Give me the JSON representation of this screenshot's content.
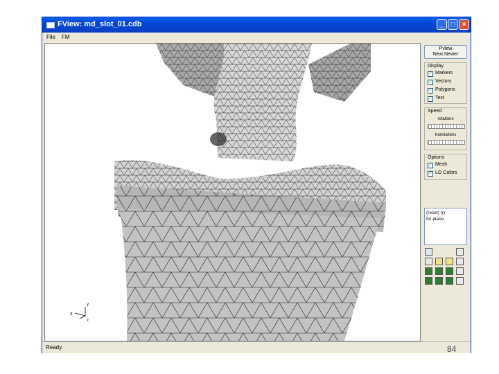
{
  "window": {
    "title": "FView: md_slot_01.cdb",
    "minimize": "_",
    "maximize": "□",
    "close": "×"
  },
  "menu": [
    "File",
    "FM"
  ],
  "panel": {
    "view_button": "Pvlew",
    "next_button": "Next Newer",
    "display": {
      "title": "Display",
      "items": [
        {
          "label": "Markers",
          "checked": true
        },
        {
          "label": "Vectors",
          "checked": true
        },
        {
          "label": "Polygons",
          "checked": true
        },
        {
          "label": "Text",
          "checked": true
        }
      ]
    },
    "speed": {
      "title": "Speed",
      "rotations_label": "rotations",
      "translations_label": "translations"
    },
    "options": {
      "title": "Options",
      "items": [
        {
          "label": "Mesh",
          "checked": true
        },
        {
          "label": "LO Colors",
          "checked": true
        }
      ]
    },
    "text_lines": [
      "(reset) (r)",
      "for plane"
    ]
  },
  "axis_labels": {
    "y": "y",
    "x": "x",
    "z": "z"
  },
  "status": "Ready.",
  "page_number": "84",
  "colors": {
    "title_bar": "#0a4fd8",
    "mesh_face": "#c9c9c9",
    "mesh_line": "#222222"
  }
}
